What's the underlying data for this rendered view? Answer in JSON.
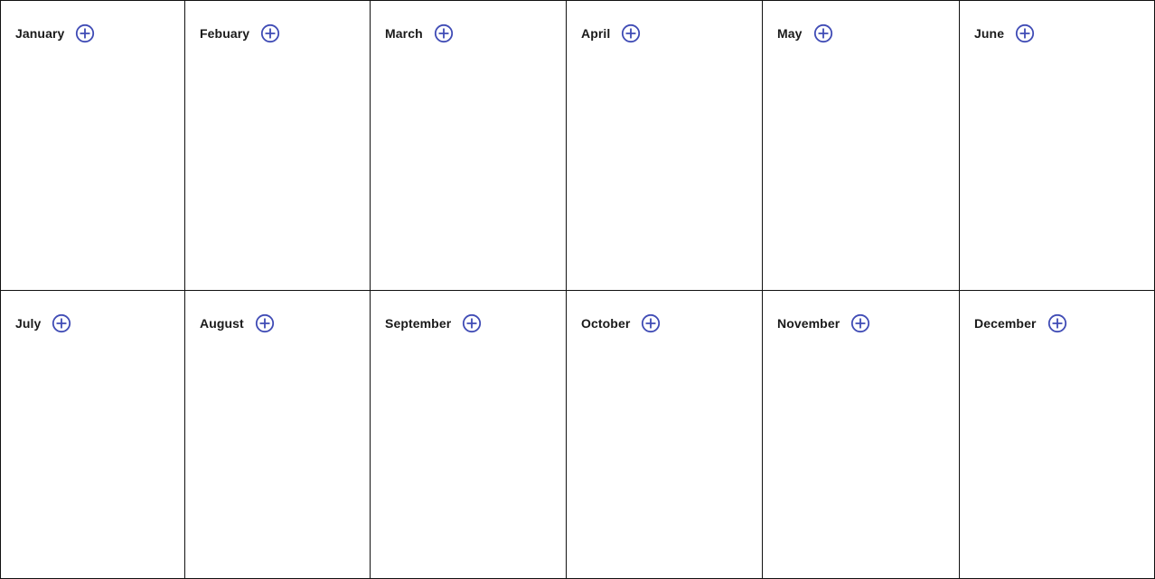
{
  "accent_color": "#3f4bb5",
  "months": [
    {
      "name": "January",
      "add_icon": "plus-circle-icon"
    },
    {
      "name": "Febuary",
      "add_icon": "plus-circle-icon"
    },
    {
      "name": "March",
      "add_icon": "plus-circle-icon"
    },
    {
      "name": "April",
      "add_icon": "plus-circle-icon"
    },
    {
      "name": "May",
      "add_icon": "plus-circle-icon"
    },
    {
      "name": "June",
      "add_icon": "plus-circle-icon"
    },
    {
      "name": "July",
      "add_icon": "plus-circle-icon"
    },
    {
      "name": "August",
      "add_icon": "plus-circle-icon"
    },
    {
      "name": "September",
      "add_icon": "plus-circle-icon"
    },
    {
      "name": "October",
      "add_icon": "plus-circle-icon"
    },
    {
      "name": "November",
      "add_icon": "plus-circle-icon"
    },
    {
      "name": "December",
      "add_icon": "plus-circle-icon"
    }
  ]
}
